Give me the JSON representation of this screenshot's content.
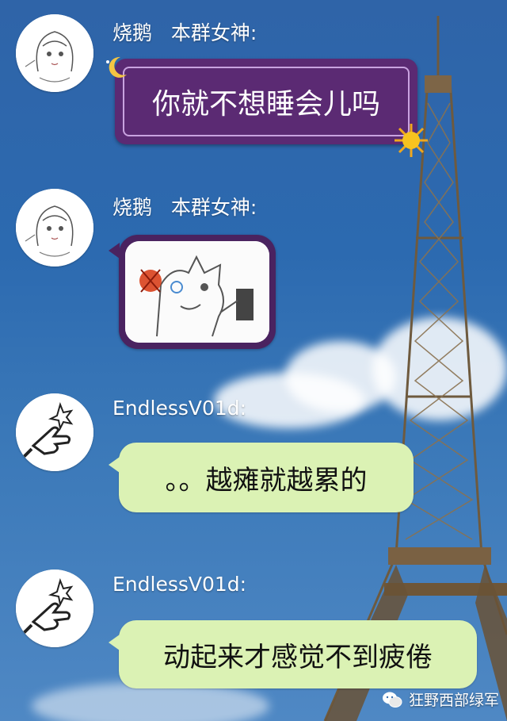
{
  "messages": [
    {
      "sender": "烧鹅   本群女神:",
      "text": "你就不想睡会儿吗",
      "style": "purple-decorated",
      "avatar_icon": "anime-girl-avatar"
    },
    {
      "sender": "烧鹅   本群女神:",
      "type": "sticker",
      "sticker_icon": "cat-shooting-sticker",
      "avatar_icon": "anime-girl-avatar"
    },
    {
      "sender": "EndlessV01d:",
      "text": "。。越瘫就越累的",
      "avatar_icon": "finger-gun-avatar"
    },
    {
      "sender": "EndlessV01d:",
      "text": "动起来才感觉不到疲倦",
      "avatar_icon": "finger-gun-avatar"
    }
  ],
  "watermark": {
    "text": "狂野西部绿军",
    "icon": "wechat-icon"
  },
  "colors": {
    "green_bubble": "#dbf2b4",
    "purple_bubble": "#5b2a73",
    "sky": "#2f64a8"
  }
}
